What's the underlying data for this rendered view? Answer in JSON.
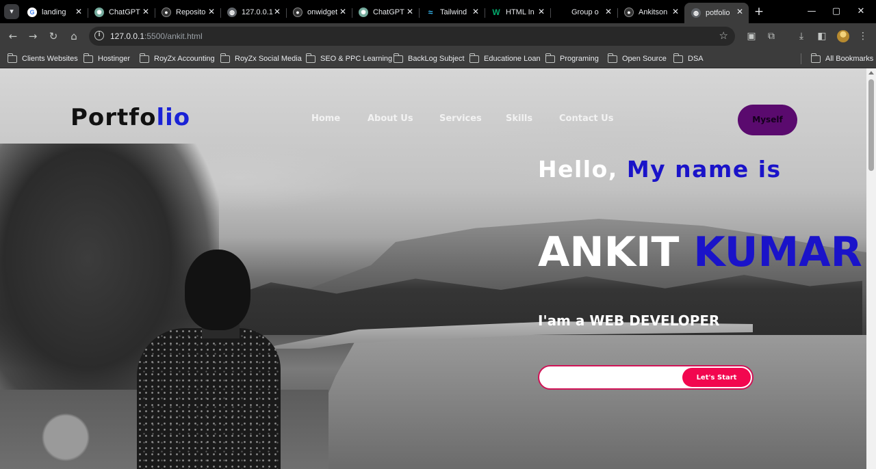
{
  "browser": {
    "tabs": [
      {
        "title": "landing",
        "favicon": "google-icon",
        "color": "#ffffff"
      },
      {
        "title": "ChatGPT",
        "favicon": "chatgpt-icon",
        "color": "#74aa9c"
      },
      {
        "title": "Reposito",
        "favicon": "github-icon",
        "color": "#333333"
      },
      {
        "title": "127.0.0.1",
        "favicon": "globe-icon",
        "color": "#5f6368"
      },
      {
        "title": "onwidget",
        "favicon": "github-icon",
        "color": "#333333"
      },
      {
        "title": "ChatGPT",
        "favicon": "chatgpt-icon",
        "color": "#74aa9c"
      },
      {
        "title": "Tailwind",
        "favicon": "tailwind-icon",
        "color": "#38bdf8"
      },
      {
        "title": "HTML In",
        "favicon": "w3schools-icon",
        "color": "#04aa6d"
      },
      {
        "title": "Group o",
        "favicon": "none",
        "color": "#000000"
      },
      {
        "title": "Ankitson",
        "favicon": "github-icon",
        "color": "#333333"
      },
      {
        "title": "potfolio",
        "favicon": "globe-icon",
        "color": "#5f6368",
        "active": true
      }
    ],
    "url": {
      "host": "127.0.0.1",
      "path": ":5500/ankit.html"
    },
    "bookmarks": [
      "Clients Websites",
      "Hostinger",
      "RoyZx Accounting",
      "RoyZx Social Media",
      "SEO & PPC Learning",
      "BackLog Subject",
      "Educatione Loan",
      "Programing",
      "Open Source",
      "DSA"
    ],
    "all_bookmarks": "All Bookmarks"
  },
  "site": {
    "logo": {
      "part1": "Portfo",
      "part2": "lio"
    },
    "nav": [
      "Home",
      "About Us",
      "Services",
      "Skills",
      "Contact Us"
    ],
    "cta_top": "Myself",
    "hello": {
      "white": "Hello,",
      "blue": "My name is"
    },
    "name": {
      "white": "ANKIT",
      "blue": "KUMAR"
    },
    "role": "I'am a WEB DEVELOPER",
    "start_button": "Let's Start"
  },
  "colors": {
    "accent_blue": "#1a13c9",
    "button_pink": "#f2074f",
    "myself_purple": "#5a0a6e"
  }
}
